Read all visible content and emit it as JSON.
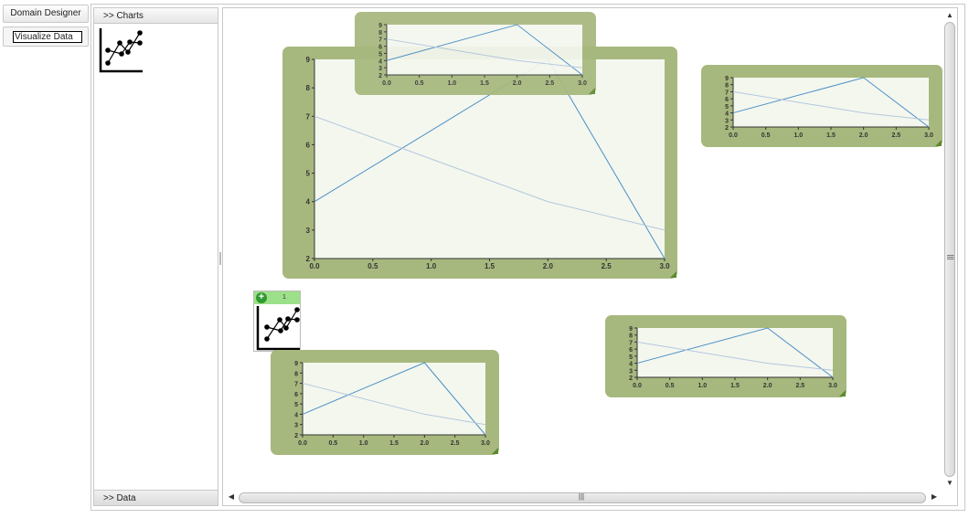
{
  "nav": {
    "domain_designer": "Domain Designer",
    "visualize_data": "Visualize Data"
  },
  "palette": {
    "header": ">> Charts",
    "footer": ">> Data"
  },
  "drag_preview": {
    "count": "1"
  },
  "scrollbars": {
    "grip": "|||"
  },
  "colors": {
    "widget_frame": "#a7b87e",
    "plot_bg": "#f4f7ee",
    "series_primary": "#4a8fc7",
    "series_secondary": "#b4c8df"
  },
  "chart_data": [
    {
      "type": "line",
      "x": [
        0,
        2,
        3
      ],
      "series": [
        {
          "values": [
            4,
            9,
            2
          ]
        },
        {
          "values": [
            7,
            4,
            3
          ]
        }
      ],
      "xticks": [
        "0.0",
        "0.5",
        "1.0",
        "1.5",
        "2.0",
        "2.5",
        "3.0"
      ],
      "yticks": [
        "2",
        "3",
        "4",
        "5",
        "6",
        "7",
        "8",
        "9"
      ],
      "xlim": [
        0,
        3
      ],
      "ylim": [
        2,
        9
      ]
    },
    {
      "type": "line",
      "x": [
        0,
        2,
        3
      ],
      "series": [
        {
          "values": [
            4,
            9,
            2
          ]
        },
        {
          "values": [
            7,
            4,
            3
          ]
        }
      ],
      "xticks": [
        "0.0",
        "0.5",
        "1.0",
        "1.5",
        "2.0",
        "2.5",
        "3.0"
      ],
      "yticks": [
        "2",
        "3",
        "4",
        "5",
        "6",
        "7",
        "8",
        "9"
      ],
      "xlim": [
        0,
        3
      ],
      "ylim": [
        2,
        9
      ]
    },
    {
      "type": "line",
      "x": [
        0,
        2,
        3
      ],
      "series": [
        {
          "values": [
            4,
            9,
            2
          ]
        },
        {
          "values": [
            7,
            4,
            3
          ]
        }
      ],
      "xticks": [
        "0.0",
        "0.5",
        "1.0",
        "1.5",
        "2.0",
        "2.5",
        "3.0"
      ],
      "yticks": [
        "2",
        "3",
        "4",
        "5",
        "6",
        "7",
        "8",
        "9"
      ],
      "xlim": [
        0,
        3
      ],
      "ylim": [
        2,
        9
      ]
    },
    {
      "type": "line",
      "x": [
        0,
        2,
        3
      ],
      "series": [
        {
          "values": [
            4,
            9,
            2
          ]
        },
        {
          "values": [
            7,
            4,
            3
          ]
        }
      ],
      "xticks": [
        "0.0",
        "0.5",
        "1.0",
        "1.5",
        "2.0",
        "2.5",
        "3.0"
      ],
      "yticks": [
        "2",
        "3",
        "4",
        "5",
        "6",
        "7",
        "8",
        "9"
      ],
      "xlim": [
        0,
        3
      ],
      "ylim": [
        2,
        9
      ]
    },
    {
      "type": "line",
      "x": [
        0,
        2,
        3
      ],
      "series": [
        {
          "values": [
            4,
            9,
            2
          ]
        },
        {
          "values": [
            7,
            4,
            3
          ]
        }
      ],
      "xticks": [
        "0.0",
        "0.5",
        "1.0",
        "1.5",
        "2.0",
        "2.5",
        "3.0"
      ],
      "yticks": [
        "2",
        "3",
        "4",
        "5",
        "6",
        "7",
        "8",
        "9"
      ],
      "xlim": [
        0,
        3
      ],
      "ylim": [
        2,
        9
      ]
    }
  ]
}
